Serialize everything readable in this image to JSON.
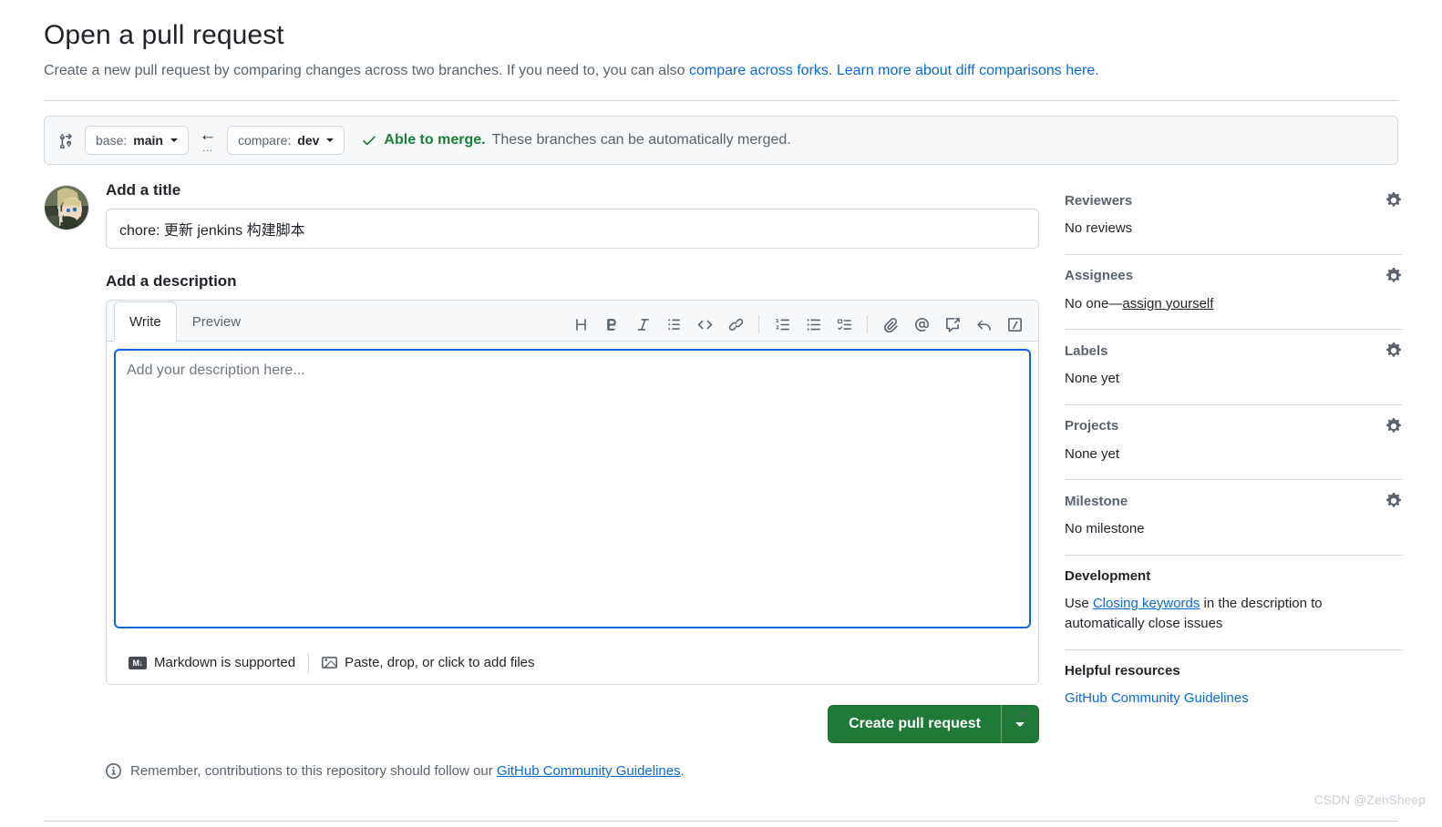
{
  "header": {
    "title": "Open a pull request",
    "subtitle_prefix": "Create a new pull request by comparing changes across two branches. If you need to, you can also ",
    "link_forks": "compare across forks.",
    "subtitle_mid": " ",
    "link_diff": "Learn more about diff comparisons here."
  },
  "branch_bar": {
    "compare_icon": "git-compare-icon",
    "base_label": "base:",
    "base_branch": "main",
    "arrow": "←",
    "arrow_dots": "...",
    "compare_label": "compare:",
    "compare_branch": "dev",
    "check_icon": "check-icon",
    "merge_status": "Able to merge.",
    "merge_detail": "These branches can be automatically merged."
  },
  "form": {
    "title_label": "Add a title",
    "title_value": "chore: 更新 jenkins 构建脚本",
    "title_placeholder": "Title",
    "description_label": "Add a description",
    "tabs": [
      {
        "label": "Write",
        "active": true
      },
      {
        "label": "Preview",
        "active": false
      }
    ],
    "toolbar": [
      {
        "name": "heading-icon",
        "title": "Heading"
      },
      {
        "name": "bold-icon",
        "title": "Bold"
      },
      {
        "name": "italic-icon",
        "title": "Italic"
      },
      {
        "name": "quote-icon",
        "title": "Quote"
      },
      {
        "name": "code-icon",
        "title": "Code"
      },
      {
        "name": "link-icon",
        "title": "Link"
      },
      {
        "name": "ordered-list-icon",
        "title": "Numbered list"
      },
      {
        "name": "unordered-list-icon",
        "title": "Unordered list"
      },
      {
        "name": "task-list-icon",
        "title": "Task list"
      },
      {
        "name": "attach-file-icon",
        "title": "Attach files"
      },
      {
        "name": "mention-icon",
        "title": "Mention"
      },
      {
        "name": "saved-reply-icon",
        "title": "Reference"
      },
      {
        "name": "reply-icon",
        "title": "Reply"
      },
      {
        "name": "slash-command-icon",
        "title": "Slash commands"
      }
    ],
    "description_value": "",
    "description_placeholder": "Add your description here...",
    "markdown_note": "Markdown is supported",
    "markdown_badge": "M↓",
    "attach_note": "Paste, drop, or click to add files",
    "submit_label": "Create pull request",
    "submit_color": "#1f7a37",
    "remember_prefix": "Remember, contributions to this repository should follow our ",
    "remember_link": "GitHub Community Guidelines",
    "remember_suffix": "."
  },
  "sidebar": {
    "sections": [
      {
        "title": "Reviewers",
        "gear": "gear-icon",
        "body": "No reviews",
        "link": "",
        "body_suffix": "",
        "dark": false
      },
      {
        "title": "Assignees",
        "gear": "gear-icon",
        "body": "No one—",
        "link": "assign yourself",
        "body_suffix": "",
        "dark": false
      },
      {
        "title": "Labels",
        "gear": "gear-icon",
        "body": "None yet",
        "link": "",
        "body_suffix": "",
        "dark": false
      },
      {
        "title": "Projects",
        "gear": "gear-icon",
        "body": "None yet",
        "link": "",
        "body_suffix": "",
        "dark": false
      },
      {
        "title": "Milestone",
        "gear": "gear-icon",
        "body": "No milestone",
        "link": "",
        "body_suffix": "",
        "dark": false
      }
    ],
    "development": {
      "title": "Development",
      "prefix": "Use ",
      "link": "Closing keywords",
      "suffix": " in the description to automatically close issues"
    },
    "helpful": {
      "title": "Helpful resources",
      "link": "GitHub Community Guidelines"
    }
  },
  "watermark": "CSDN @ZenSheep"
}
